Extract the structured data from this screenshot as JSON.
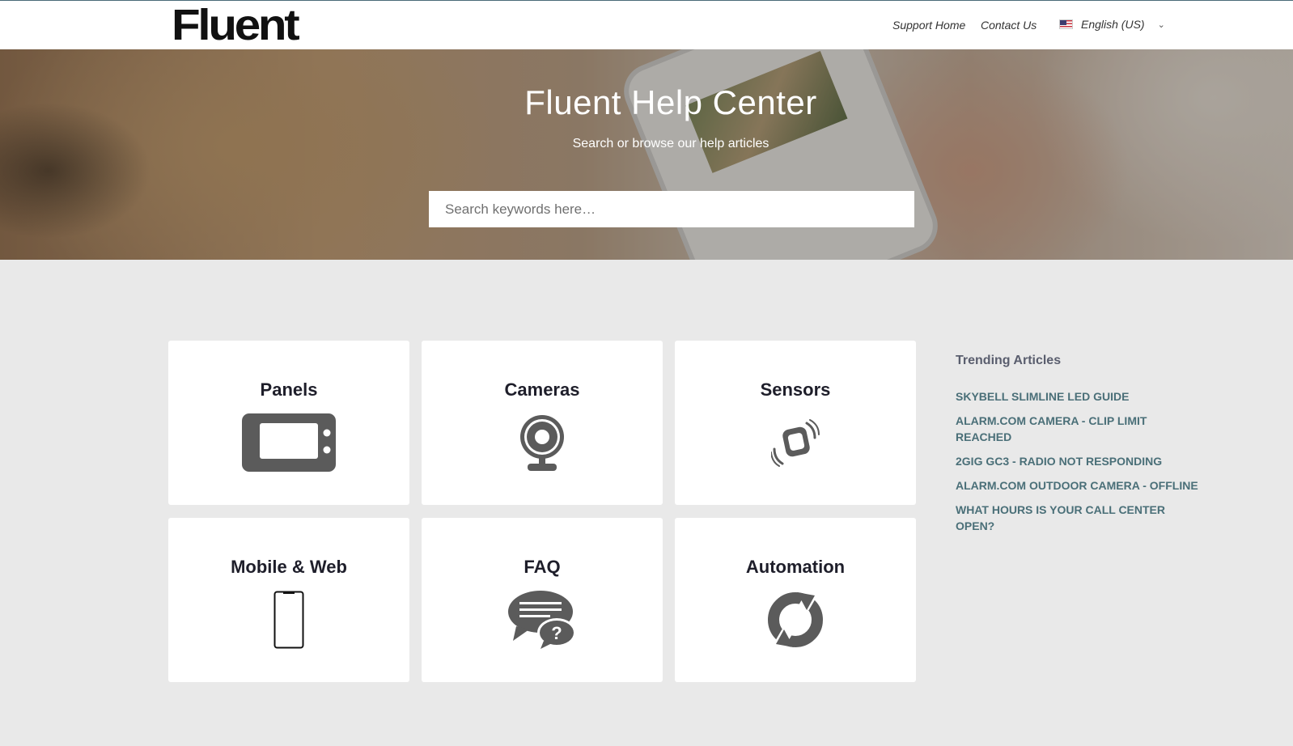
{
  "header": {
    "logo_text": "Fluent",
    "nav": {
      "support_home": "Support Home",
      "contact_us": "Contact Us",
      "language": "English (US)"
    }
  },
  "hero": {
    "title": "Fluent Help Center",
    "subtitle": "Search or browse our help articles",
    "search_placeholder": "Search keywords here…"
  },
  "categories": [
    {
      "label": "Panels",
      "icon": "panel-icon"
    },
    {
      "label": "Cameras",
      "icon": "camera-icon"
    },
    {
      "label": "Sensors",
      "icon": "sensor-icon"
    },
    {
      "label": "Mobile & Web",
      "icon": "mobile-phone-icon"
    },
    {
      "label": "FAQ",
      "icon": "faq-chat-icon"
    },
    {
      "label": "Automation",
      "icon": "automation-refresh-icon"
    }
  ],
  "trending": {
    "title": "Trending Articles",
    "items": [
      "SKYBELL SLIMLINE LED GUIDE",
      "ALARM.COM CAMERA - CLIP LIMIT REACHED",
      "2GIG GC3 - RADIO NOT RESPONDING",
      "ALARM.COM OUTDOOR CAMERA - OFFLINE",
      "WHAT HOURS IS YOUR CALL CENTER OPEN?"
    ]
  },
  "colors": {
    "icon_gray": "#5b5b5b",
    "link_teal": "#4a6f78",
    "page_bg": "#e9e9e9"
  }
}
